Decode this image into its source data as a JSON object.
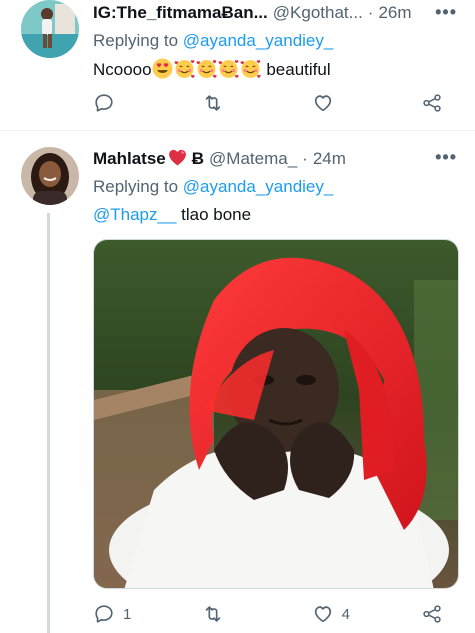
{
  "tweets": [
    {
      "display_name": "IG:The_fitmamaɃan...",
      "handle": "@Kgothat...",
      "dot": "·",
      "time": "26m",
      "replying_label": "Replying to",
      "replying_to": "@ayanda_yandiey_",
      "text_prefix": "Ncoooo",
      "text_suffix": "beautiful",
      "emojis": [
        "heart-eyes-emoji",
        "smiling-face-hearts-emoji",
        "smiling-face-hearts-emoji",
        "smiling-face-hearts-emoji",
        "smiling-face-hearts-emoji"
      ],
      "actions": {
        "reply_count": "",
        "retweet_count": "",
        "like_count": ""
      }
    },
    {
      "display_name": "Mahlatse",
      "name_badges": [
        "heart-emoji",
        "bitcoin-symbol"
      ],
      "bitcoin_symbol": "Ƀ",
      "handle": "@Matema_",
      "dot": "·",
      "time": "24m",
      "replying_label": "Replying to",
      "replying_to": "@ayanda_yandiey_",
      "mention": "@Thapz__",
      "text": " tlao bone",
      "actions": {
        "reply_count": "1",
        "retweet_count": "",
        "like_count": "4"
      }
    }
  ],
  "more_icon": "more-dots-icon",
  "colors": {
    "link": "#1d9bf0",
    "secondary_text": "#536471",
    "primary_text": "#0f1419",
    "thread_line": "#cfd9de"
  }
}
